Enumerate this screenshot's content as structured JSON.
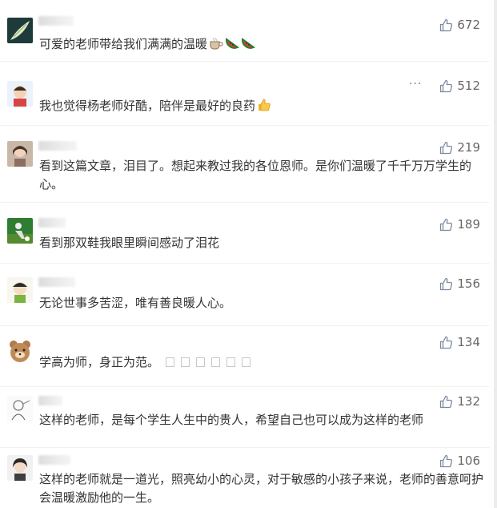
{
  "comments": [
    {
      "text": "可爱的老师带给我们满满的温暖",
      "likes": "672",
      "avatar_icon": "avatar-leaf-icon"
    },
    {
      "text": "我也觉得杨老师好酷，陪伴是最好的良药",
      "likes": "512",
      "more_label": "···",
      "avatar_icon": "avatar-child-icon"
    },
    {
      "text": "看到这篇文章，泪目了。想起来教过我的各位恩师。是你们温暖了千千万万学生的心。",
      "likes": "219",
      "avatar_icon": "avatar-person-icon"
    },
    {
      "text": "看到那双鞋我眼里瞬间感动了泪花",
      "likes": "189",
      "avatar_icon": "avatar-sport-icon"
    },
    {
      "text": "无论世事多苦涩，唯有善良暖人心。",
      "likes": "156",
      "avatar_icon": "avatar-cartoon-icon"
    },
    {
      "text": "学高为师，身正为范。",
      "likes": "134",
      "avatar_icon": "avatar-bear-icon"
    },
    {
      "text": "这样的老师，是每个学生人生中的贵人，希望自己也可以成为这样的老师",
      "likes": "132",
      "avatar_icon": "avatar-sketch-icon"
    },
    {
      "text": "这样的老师就是一道光，照亮幼小的心灵，对于敏感的小孩子来说，老师的善意呵护会温暖激励他的一生。",
      "likes": "106",
      "avatar_icon": "avatar-girl-icon"
    }
  ],
  "colors": {
    "text": "#333333",
    "meta": "#666666",
    "like_icon": "#7b8aa0"
  }
}
